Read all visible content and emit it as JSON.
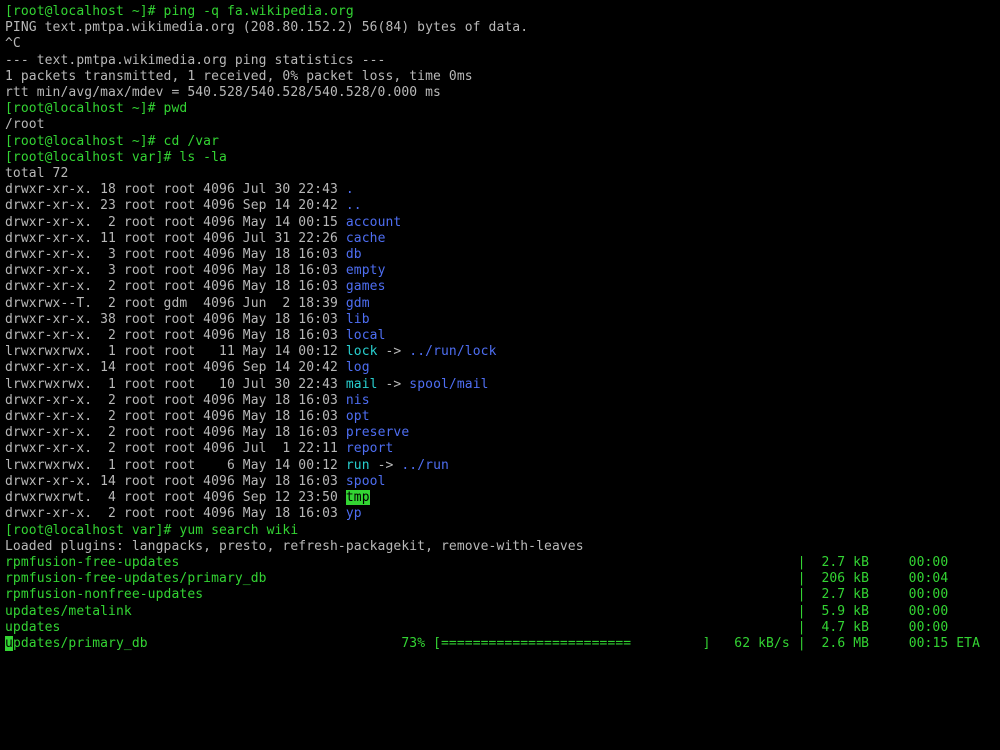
{
  "prompts": {
    "home": "[root@localhost ~]#",
    "var": "[root@localhost var]#"
  },
  "commands": {
    "ping": "ping -q fa.wikipedia.org",
    "pwd": "pwd",
    "cd": "cd /var",
    "ls": "ls -la",
    "yum": "yum search wiki"
  },
  "ping": {
    "header": "PING text.pmtpa.wikimedia.org (208.80.152.2) 56(84) bytes of data.",
    "break": "^C",
    "stats_title": "--- text.pmtpa.wikimedia.org ping statistics ---",
    "stats_line1": "1 packets transmitted, 1 received, 0% packet loss, time 0ms",
    "stats_line2": "rtt min/avg/max/mdev = 540.528/540.528/540.528/0.000 ms"
  },
  "pwd_output": "/root",
  "ls_total": "total 72",
  "ls_entries": [
    {
      "perms": "drwxr-xr-x.",
      "n": "18",
      "own": "root",
      "grp": "root",
      "size": "4096",
      "date": "Jul 30 22:43",
      "name": ".",
      "type": "dir"
    },
    {
      "perms": "drwxr-xr-x.",
      "n": "23",
      "own": "root",
      "grp": "root",
      "size": "4096",
      "date": "Sep 14 20:42",
      "name": "..",
      "type": "dir"
    },
    {
      "perms": "drwxr-xr-x.",
      "n": " 2",
      "own": "root",
      "grp": "root",
      "size": "4096",
      "date": "May 14 00:15",
      "name": "account",
      "type": "dir"
    },
    {
      "perms": "drwxr-xr-x.",
      "n": "11",
      "own": "root",
      "grp": "root",
      "size": "4096",
      "date": "Jul 31 22:26",
      "name": "cache",
      "type": "dir"
    },
    {
      "perms": "drwxr-xr-x.",
      "n": " 3",
      "own": "root",
      "grp": "root",
      "size": "4096",
      "date": "May 18 16:03",
      "name": "db",
      "type": "dir"
    },
    {
      "perms": "drwxr-xr-x.",
      "n": " 3",
      "own": "root",
      "grp": "root",
      "size": "4096",
      "date": "May 18 16:03",
      "name": "empty",
      "type": "dir"
    },
    {
      "perms": "drwxr-xr-x.",
      "n": " 2",
      "own": "root",
      "grp": "root",
      "size": "4096",
      "date": "May 18 16:03",
      "name": "games",
      "type": "dir"
    },
    {
      "perms": "drwxrwx--T.",
      "n": " 2",
      "own": "root",
      "grp": "gdm ",
      "size": "4096",
      "date": "Jun  2 18:39",
      "name": "gdm",
      "type": "dir"
    },
    {
      "perms": "drwxr-xr-x.",
      "n": "38",
      "own": "root",
      "grp": "root",
      "size": "4096",
      "date": "May 18 16:03",
      "name": "lib",
      "type": "dir"
    },
    {
      "perms": "drwxr-xr-x.",
      "n": " 2",
      "own": "root",
      "grp": "root",
      "size": "4096",
      "date": "May 18 16:03",
      "name": "local",
      "type": "dir"
    },
    {
      "perms": "lrwxrwxrwx.",
      "n": " 1",
      "own": "root",
      "grp": "root",
      "size": "  11",
      "date": "May 14 00:12",
      "name": "lock",
      "type": "link",
      "target": "../run/lock"
    },
    {
      "perms": "drwxr-xr-x.",
      "n": "14",
      "own": "root",
      "grp": "root",
      "size": "4096",
      "date": "Sep 14 20:42",
      "name": "log",
      "type": "dir"
    },
    {
      "perms": "lrwxrwxrwx.",
      "n": " 1",
      "own": "root",
      "grp": "root",
      "size": "  10",
      "date": "Jul 30 22:43",
      "name": "mail",
      "type": "link",
      "target": "spool/mail"
    },
    {
      "perms": "drwxr-xr-x.",
      "n": " 2",
      "own": "root",
      "grp": "root",
      "size": "4096",
      "date": "May 18 16:03",
      "name": "nis",
      "type": "dir"
    },
    {
      "perms": "drwxr-xr-x.",
      "n": " 2",
      "own": "root",
      "grp": "root",
      "size": "4096",
      "date": "May 18 16:03",
      "name": "opt",
      "type": "dir"
    },
    {
      "perms": "drwxr-xr-x.",
      "n": " 2",
      "own": "root",
      "grp": "root",
      "size": "4096",
      "date": "May 18 16:03",
      "name": "preserve",
      "type": "dir"
    },
    {
      "perms": "drwxr-xr-x.",
      "n": " 2",
      "own": "root",
      "grp": "root",
      "size": "4096",
      "date": "Jul  1 22:11",
      "name": "report",
      "type": "dir"
    },
    {
      "perms": "lrwxrwxrwx.",
      "n": " 1",
      "own": "root",
      "grp": "root",
      "size": "   6",
      "date": "May 14 00:12",
      "name": "run",
      "type": "link",
      "target": "../run"
    },
    {
      "perms": "drwxr-xr-x.",
      "n": "14",
      "own": "root",
      "grp": "root",
      "size": "4096",
      "date": "May 18 16:03",
      "name": "spool",
      "type": "dir"
    },
    {
      "perms": "drwxrwxrwt.",
      "n": " 4",
      "own": "root",
      "grp": "root",
      "size": "4096",
      "date": "Sep 12 23:50",
      "name": "tmp",
      "type": "sticky"
    },
    {
      "perms": "drwxr-xr-x.",
      "n": " 2",
      "own": "root",
      "grp": "root",
      "size": "4096",
      "date": "May 18 16:03",
      "name": "yp",
      "type": "dir"
    }
  ],
  "yum": {
    "plugins": "Loaded plugins: langpacks, presto, refresh-packagekit, remove-with-leaves",
    "repos": [
      {
        "name": "rpmfusion-free-updates",
        "size": "2.7 kB",
        "time": "00:00"
      },
      {
        "name": "rpmfusion-free-updates/primary_db",
        "size": "206 kB",
        "time": "00:04"
      },
      {
        "name": "rpmfusion-nonfree-updates",
        "size": "2.7 kB",
        "time": "00:00"
      },
      {
        "name": "updates/metalink",
        "size": "5.9 kB",
        "time": "00:00"
      },
      {
        "name": "updates",
        "size": "4.7 kB",
        "time": "00:00"
      }
    ],
    "progress": {
      "name": "updates/primary_db",
      "first_char": "u",
      "rest": "pdates/primary_db",
      "pct": "73%",
      "bar_filled": "========================",
      "speed": "62 kB/s",
      "size": "2.6 MB",
      "eta": "00:15 ETA"
    }
  }
}
